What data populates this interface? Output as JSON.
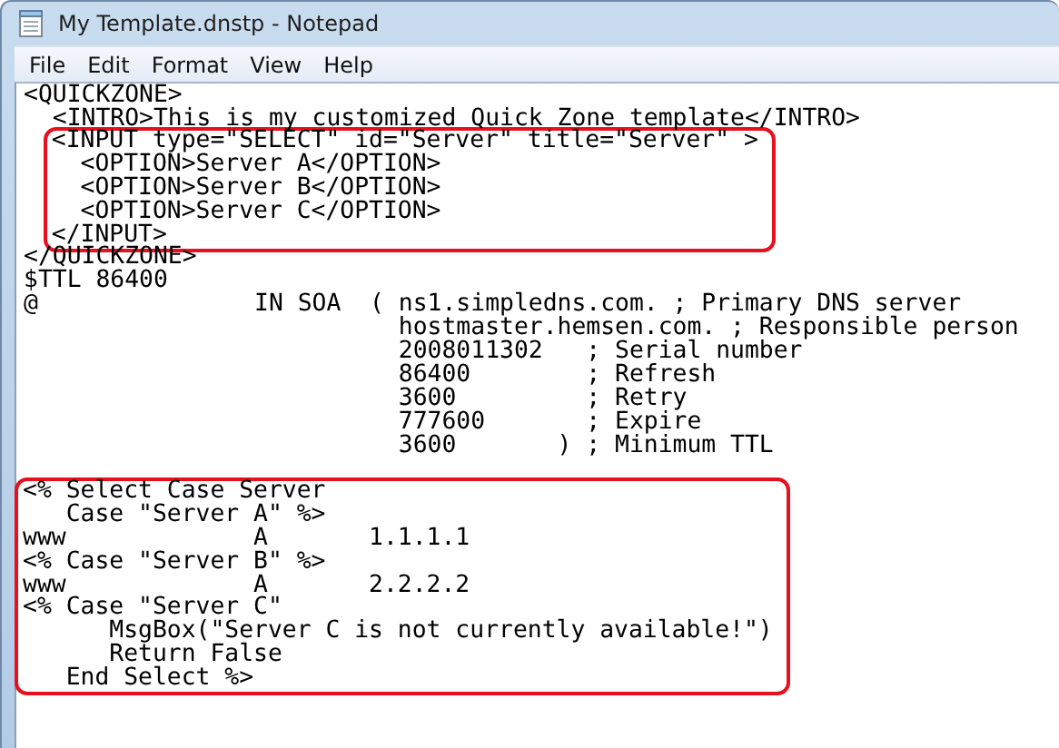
{
  "window": {
    "title": "My Template.dnstp - Notepad"
  },
  "menu": [
    "File",
    "Edit",
    "Format",
    "View",
    "Help"
  ],
  "editor": {
    "blocks": [
      {
        "highlighted": false,
        "lines": [
          "<QUICKZONE>",
          "  <INTRO>This is my customized Quick Zone template</INTRO>"
        ]
      },
      {
        "highlighted": true,
        "lines": [
          "  <INPUT type=\"SELECT\" id=\"Server\" title=\"Server\" >",
          "    <OPTION>Server A</OPTION>",
          "    <OPTION>Server B</OPTION>",
          "    <OPTION>Server C</OPTION>",
          "  </INPUT>"
        ]
      },
      {
        "highlighted": false,
        "lines": [
          "</QUICKZONE>",
          "$TTL 86400",
          "@               IN SOA  ( ns1.simpledns.com. ; Primary DNS server",
          "                          hostmaster.hemsen.com. ; Responsible person",
          "                          2008011302   ; Serial number",
          "                          86400        ; Refresh",
          "                          3600         ; Retry",
          "                          777600       ; Expire",
          "                          3600       ) ; Minimum TTL"
        ]
      },
      {
        "highlighted": true,
        "lines": [
          "<% Select Case Server",
          "   Case \"Server A\" %>",
          "www             A       1.1.1.1",
          "<% Case \"Server B\" %>",
          "www             A       2.2.2.2",
          "<% Case \"Server C\"",
          "      MsgBox(\"Server C is not currently available!\")",
          "      Return False",
          "   End Select %>"
        ]
      }
    ]
  }
}
